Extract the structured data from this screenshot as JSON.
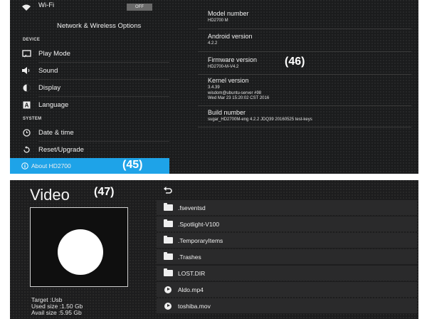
{
  "settings": {
    "wifi": {
      "label": "Wi-Fi",
      "toggle": "OFF"
    },
    "network_label": "Network & Wireless Options",
    "section_device": "DEVICE",
    "device_items": [
      {
        "label": "Play Mode",
        "icon": "screen-icon"
      },
      {
        "label": "Sound",
        "icon": "speaker-icon"
      },
      {
        "label": "Display",
        "icon": "brightness-icon"
      },
      {
        "label": "Language",
        "icon": "language-icon"
      }
    ],
    "section_system": "SYSTEM",
    "system_items": [
      {
        "label": "Date & time",
        "icon": "clock-icon"
      },
      {
        "label": "Reset/Upgrade",
        "icon": "restore-icon"
      },
      {
        "label": "About HD2700",
        "icon": "info-icon",
        "active": true
      }
    ],
    "accent_color": "#1ea3e8",
    "info": [
      {
        "title": "Model number",
        "value": "HD2700 M"
      },
      {
        "title": "Android version",
        "value": "4.2.2"
      },
      {
        "title": "Firmware version",
        "value": "HD2700-M-V4.2"
      },
      {
        "title": "Kernel version",
        "value": "3.4.39\nwisdom@ubuntu-server #98\nWed Mar 23 15:20:02 CST 2016"
      },
      {
        "title": "Build number",
        "value": "sugar_HD2700M-eng 4.2.2 JDQ39 20160525 test-keys"
      }
    ],
    "callouts": {
      "info": "(46)",
      "about": "(45)"
    }
  },
  "video": {
    "title": "Video",
    "callout": "(47)",
    "storage": {
      "target": "Target :Usb",
      "used": "Used size :1.50 Gb",
      "avail": "Avail size :5.95 Gb"
    },
    "back_icon": "back-icon",
    "files": [
      {
        "name": ".fseventsd",
        "type": "folder"
      },
      {
        "name": ".Spotlight-V100",
        "type": "folder"
      },
      {
        "name": ".TemporaryItems",
        "type": "folder"
      },
      {
        "name": ".Trashes",
        "type": "folder"
      },
      {
        "name": "LOST.DIR",
        "type": "folder"
      },
      {
        "name": "Aldo.mp4",
        "type": "video"
      },
      {
        "name": "toshiba.mov",
        "type": "video"
      }
    ]
  }
}
